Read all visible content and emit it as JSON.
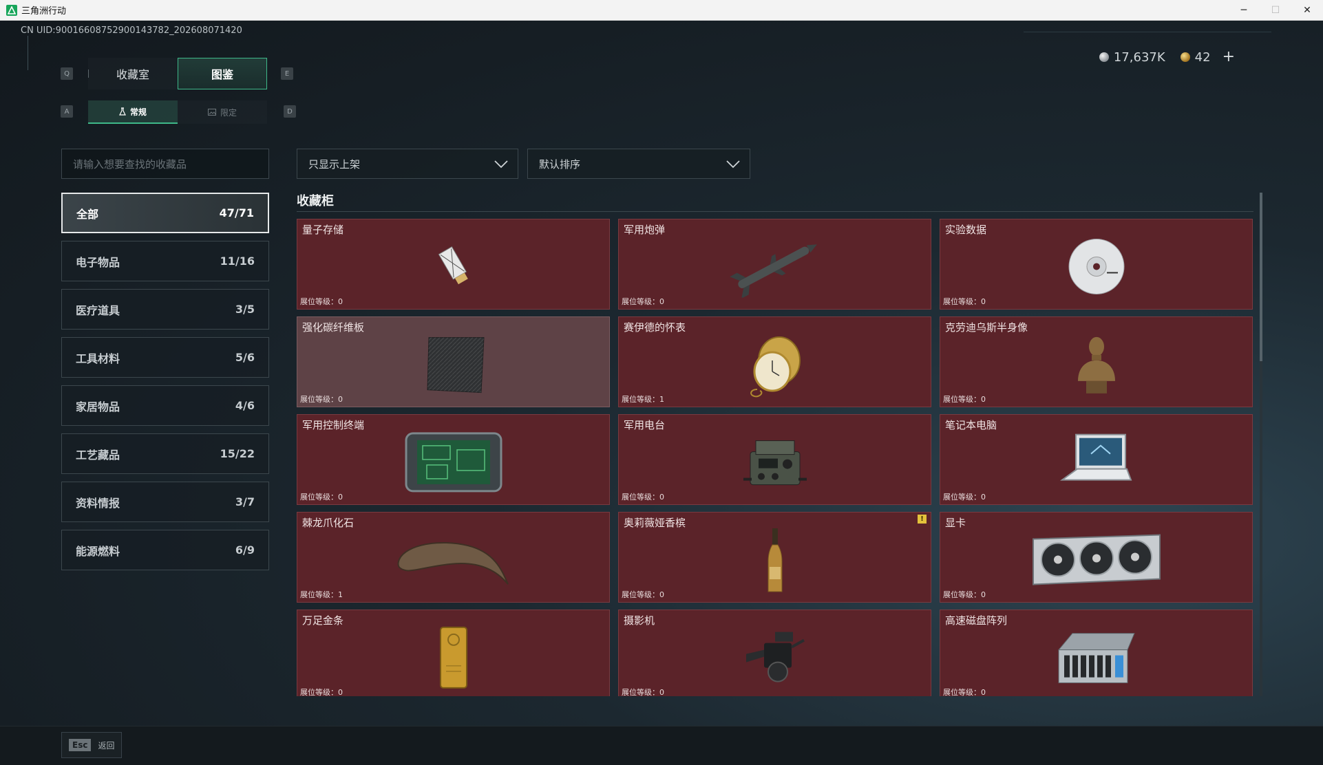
{
  "window": {
    "title": "三角洲行动",
    "controls": {
      "minimize": "─",
      "maximize": "☐",
      "close": "✕"
    }
  },
  "uid_text": "CN UID:9001660875290014378​2_202608071420",
  "currency": {
    "silver": "17,637K",
    "gold": "42",
    "add": "+"
  },
  "keys": {
    "prev_tab": "Q",
    "next_tab": "E",
    "prev_sub": "A",
    "next_sub": "D"
  },
  "tabs": [
    {
      "label": "收藏室",
      "active": false
    },
    {
      "label": "图鉴",
      "active": true
    }
  ],
  "subtabs": [
    {
      "label": "常规",
      "active": true,
      "icon": "flask-icon"
    },
    {
      "label": "限定",
      "active": false,
      "icon": "image-icon"
    }
  ],
  "search": {
    "placeholder": "请输入想要查找的收藏品"
  },
  "filter": {
    "value": "只显示上架"
  },
  "sort": {
    "value": "默认排序"
  },
  "categories": [
    {
      "label": "全部",
      "count": "47/71",
      "active": true
    },
    {
      "label": "电子物品",
      "count": "11/16"
    },
    {
      "label": "医疗道具",
      "count": "3/5"
    },
    {
      "label": "工具材料",
      "count": "5/6"
    },
    {
      "label": "家居物品",
      "count": "4/6"
    },
    {
      "label": "工艺藏品",
      "count": "15/22"
    },
    {
      "label": "资料情报",
      "count": "3/7"
    },
    {
      "label": "能源燃料",
      "count": "6/9"
    }
  ],
  "section_title": "收藏柜",
  "level_prefix": "展位等级：",
  "items": [
    {
      "name": "量子存储",
      "level": "展位等级：0",
      "icon": "usb-drive-icon"
    },
    {
      "name": "军用炮弹",
      "level": "展位等级：0",
      "icon": "missile-icon"
    },
    {
      "name": "实验数据",
      "level": "展位等级：0",
      "icon": "disc-icon"
    },
    {
      "name": "强化碳纤维板",
      "level": "展位等级：0",
      "icon": "carbon-plate-icon"
    },
    {
      "name": "赛伊德的怀表",
      "level": "展位等级：1",
      "icon": "pocket-watch-icon"
    },
    {
      "name": "克劳迪乌斯半身像",
      "level": "展位等级：0",
      "icon": "bust-icon"
    },
    {
      "name": "军用控制终端",
      "level": "展位等级：0",
      "icon": "terminal-icon"
    },
    {
      "name": "军用电台",
      "level": "展位等级：0",
      "icon": "radio-icon"
    },
    {
      "name": "笔记本电脑",
      "level": "展位等级：0",
      "icon": "laptop-icon"
    },
    {
      "name": "棘龙爪化石",
      "level": "展位等级：1",
      "icon": "claw-fossil-icon"
    },
    {
      "name": "奥莉薇娅香槟",
      "level": "展位等级：0",
      "icon": "champagne-icon",
      "badge": "!"
    },
    {
      "name": "显卡",
      "level": "展位等级：0",
      "icon": "gpu-icon"
    },
    {
      "name": "万足金条",
      "level": "展位等级：0",
      "icon": "gold-bar-icon"
    },
    {
      "name": "摄影机",
      "level": "展位等级：0",
      "icon": "camera-icon"
    },
    {
      "name": "高速磁盘阵列",
      "level": "展位等级：0",
      "icon": "disk-array-icon"
    }
  ],
  "footer": {
    "key": "Esc",
    "label": "返回"
  },
  "colors": {
    "accent": "#3fb98a",
    "card": "#5b2329",
    "card_dim": "#5e4246"
  }
}
